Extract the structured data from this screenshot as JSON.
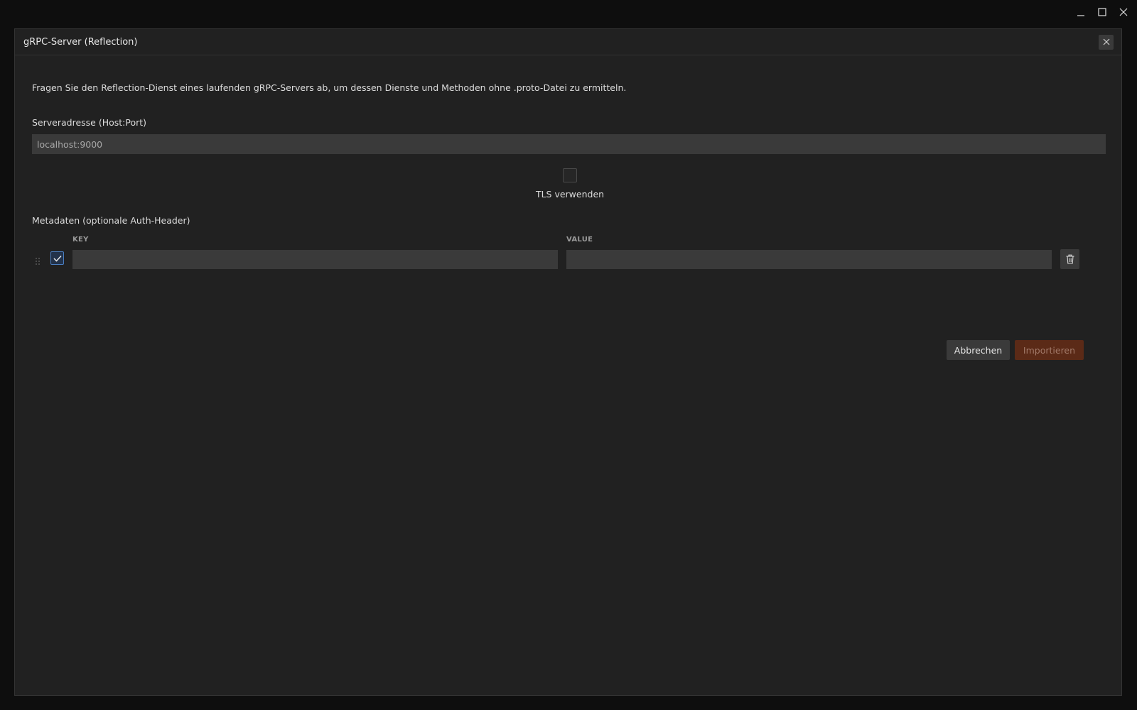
{
  "window": {
    "controls": [
      "minimize",
      "maximize",
      "close"
    ]
  },
  "dialog": {
    "title": "gRPC-Server (Reflection)",
    "description": "Fragen Sie den Reflection-Dienst eines laufenden gRPC-Servers ab, um dessen Dienste und Methoden ohne .proto-Datei zu ermitteln.",
    "server": {
      "label": "Serveradresse (Host:Port)",
      "value": "localhost:9000"
    },
    "tls": {
      "label": "TLS verwenden",
      "checked": false
    },
    "metadata": {
      "label": "Metadaten (optionale Auth-Header)",
      "columns": {
        "key": "KEY",
        "value": "VALUE"
      },
      "rows": [
        {
          "enabled": true,
          "key": "",
          "value": ""
        }
      ]
    },
    "buttons": {
      "cancel": "Abbrechen",
      "import": "Importieren"
    }
  },
  "colors": {
    "background": "#212121",
    "input": "#3a3a3a",
    "accent_disabled": "#5b2a17",
    "checkbox_accent": "#4a7ec0"
  }
}
